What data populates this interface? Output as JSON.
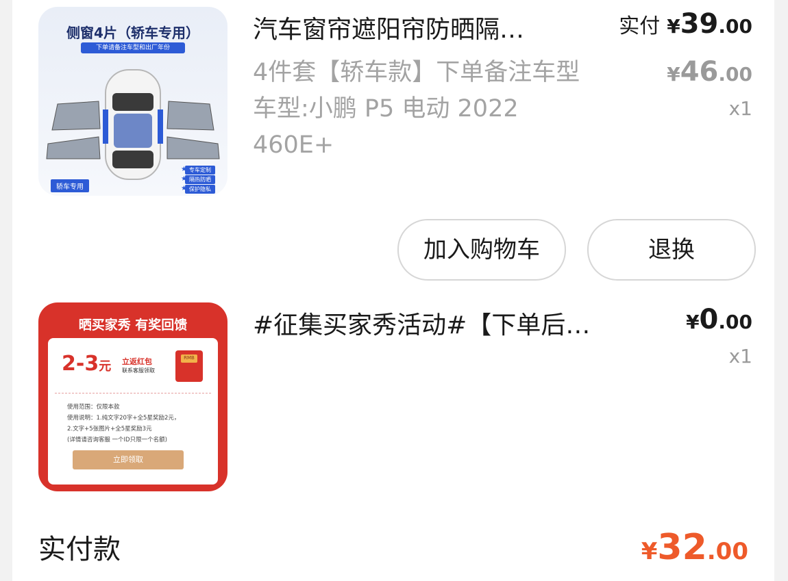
{
  "items": [
    {
      "title": "汽车窗帘遮阳帘防晒隔…",
      "sku_lines": [
        "4件套【轿车款】下单备注车型",
        "车型:小鹏 P5 电动 2022 460E+"
      ],
      "paid_label": "实付",
      "price": {
        "yen": "¥",
        "int": "39",
        "dec": ".00"
      },
      "original_price": {
        "yen": "¥",
        "int": "46",
        "dec": ".00"
      },
      "quantity": "x1",
      "thumbnail": {
        "title": "侧窗4片（轿车专用）",
        "subtitle": "下单请备注车型和出厂年份",
        "tag": "轿车专用",
        "features": [
          "专车定制",
          "隔热防晒",
          "保护隐私"
        ]
      },
      "actions": [
        "加入购物车",
        "退换"
      ]
    },
    {
      "title": "#征集买家秀活动#【下单后…",
      "price": {
        "yen": "¥",
        "int": "0",
        "dec": ".00"
      },
      "quantity": "x1",
      "thumbnail": {
        "banner": "晒买家秀  有奖回馈",
        "amount": "2-3",
        "amount_unit": "元",
        "red_title": "立返红包",
        "red_sub": "联系客服领取",
        "lines": [
          "使用范围：仅限本款",
          "使用说明：1.纯文字20字+全5星奖励2元，",
          "2.文字+5张图片+全5星奖励3元",
          "(详情请咨询客服 一个ID只限一个名额)"
        ],
        "button": "立即领取",
        "envelope_text": "RMB"
      }
    }
  ],
  "summary": {
    "label": "实付款",
    "price": {
      "yen": "¥",
      "int": "32",
      "dec": ".00"
    },
    "color": "#ee5a2a"
  }
}
